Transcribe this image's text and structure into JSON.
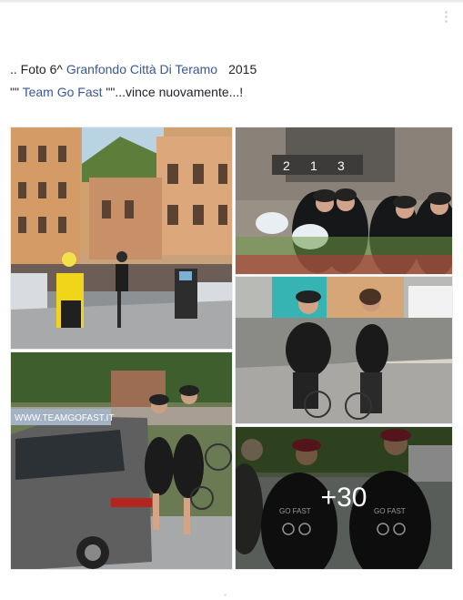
{
  "post": {
    "prefix": ".. Foto 6^ ",
    "event_link": "Granfondo Città Di Teramo",
    "year": "2015",
    "quote_open": "\"\" ",
    "team_link": "Team Go Fast",
    "quote_close": " \"\"...vince nuovamente...!"
  },
  "gallery": {
    "more_count": "+30",
    "photo1": {
      "sponsor_banner": ""
    },
    "photo3": {
      "podium_numbers": [
        "2",
        "1",
        "3"
      ]
    },
    "photo5": {
      "car_banner": "WWW.TEAMGOFAST.IT"
    },
    "photo6": {
      "jersey_text": "GO FAST"
    }
  },
  "colors": {
    "link": "#365899",
    "text": "#1d2129",
    "overlay": "rgba(0,0,0,0.42)"
  }
}
